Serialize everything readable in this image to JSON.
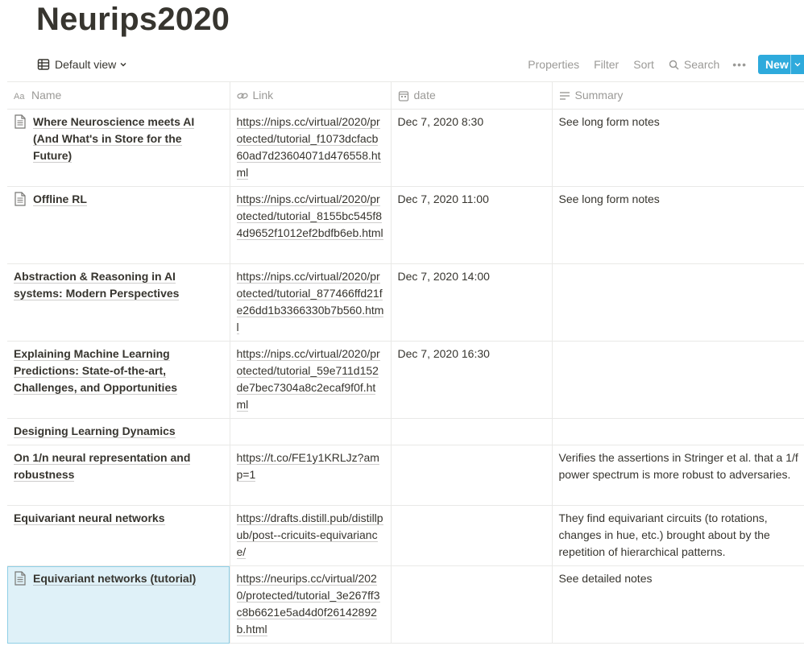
{
  "page": {
    "title": "Neurips2020"
  },
  "view": {
    "label": "Default view"
  },
  "toolbar": {
    "properties": "Properties",
    "filter": "Filter",
    "sort": "Sort",
    "search": "Search",
    "more": "•••",
    "new": "New",
    "accent": "#2eaadc"
  },
  "columns": [
    {
      "label": "Name",
      "icon": "text-property-icon"
    },
    {
      "label": "Link",
      "icon": "link-icon"
    },
    {
      "label": "date",
      "icon": "calendar-icon"
    },
    {
      "label": "Summary",
      "icon": "text-lines-icon"
    }
  ],
  "rows": [
    {
      "name": "Where Neuroscience meets AI (And What's in Store for the Future)",
      "has_icon": true,
      "link": "https://nips.cc/virtual/2020/protected/tutorial_f1073dcfacb60ad7d23604071d476558.html",
      "date": "Dec 7, 2020 8:30",
      "summary": "See long form notes"
    },
    {
      "name": "Offline RL",
      "has_icon": true,
      "link": "https://nips.cc/virtual/2020/protected/tutorial_8155bc545f84d9652f1012ef2bdfb6eb.html",
      "date": "Dec 7, 2020 11:00",
      "summary": "See long form notes"
    },
    {
      "name": "Abstraction & Reasoning in AI systems: Modern Perspectives",
      "has_icon": false,
      "link": "https://nips.cc/virtual/2020/protected/tutorial_877466ffd21fe26dd1b3366330b7b560.html",
      "date": "Dec 7, 2020 14:00",
      "summary": ""
    },
    {
      "name": "Explaining Machine Learning Predictions: State-of-the-art, Challenges, and Opportunities",
      "has_icon": false,
      "link": "https://nips.cc/virtual/2020/protected/tutorial_59e711d152de7bec7304a8c2ecaf9f0f.html",
      "date": "Dec 7, 2020 16:30",
      "summary": ""
    },
    {
      "name": "Designing Learning Dynamics",
      "has_icon": false,
      "link": "",
      "date": "",
      "summary": ""
    },
    {
      "name": "On 1/n neural representation and robustness",
      "has_icon": false,
      "link": "https://t.co/FE1y1KRLJz?amp=1",
      "date": "",
      "summary": "Verifies the assertions in Stringer et al. that a 1/f power spectrum is more robust to adversaries."
    },
    {
      "name": "Equivariant neural networks",
      "has_icon": false,
      "link": "https://drafts.distill.pub/distillpub/post--cricuits-equivariance/",
      "date": "",
      "summary": "They find equivariant circuits (to rotations, changes in hue, etc.) brought about by the repetition of hierarchical patterns."
    },
    {
      "name": "Equivariant networks (tutorial)",
      "has_icon": true,
      "link": "https://neurips.cc/virtual/2020/protected/tutorial_3e267ff3c8b6621e5ad4d0f26142892b.html",
      "date": "",
      "summary": "See detailed notes"
    }
  ]
}
